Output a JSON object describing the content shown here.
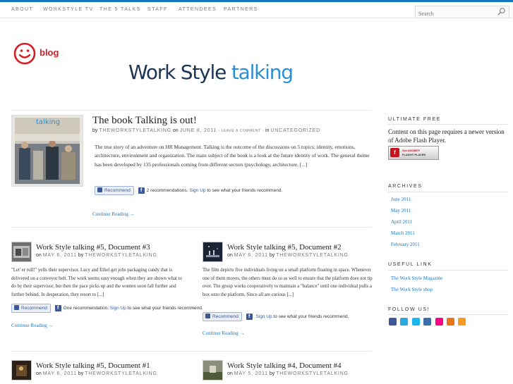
{
  "nav": {
    "items": [
      "About",
      "Workstyle TV",
      "The 5 Talks",
      "Staff",
      "Attendees",
      "Partners"
    ],
    "search_placeholder": "Search"
  },
  "header": {
    "blog_label": "blog",
    "logo_part1": "Work Style",
    "logo_part2": "talking"
  },
  "featured": {
    "title": "The book Talking is out!",
    "by": "by",
    "author": "THEWORKSTYLETALKING",
    "on": "on",
    "date": "JUNE 8, 2011",
    "sep": "·",
    "leave_comment": "LEAVE A COMMENT",
    "in": "in",
    "category": "UNCATEGORIZED",
    "thumb_caption": "talking",
    "excerpt": "The true story of an adventure on HR Management. Talking is the outcome of the discussions on 5 topics: identity, emotions, architecture, environment and organization. The main subject of the book is a look at the future identity of work. The general theme has been developed by 135 professionals coming from different sectors (psychology, architecture, [...]",
    "recommend_label": "Recommend",
    "fb_text": "2 recommendations.",
    "fb_signup": "Sign Up",
    "fb_rest": "to see what your friends recommend.",
    "continue": "Continue Reading →"
  },
  "posts": [
    {
      "title": "Work Style talking #5, Document #3",
      "on": "on",
      "date": "MAY 6, 2011",
      "by": "by",
      "author": "THEWORKSTYLETALKING",
      "excerpt": "\"Let' er roll!\" yells their supervisor. Lucy and Ethel get jobs packaging candy that is delivered on a conveyor belt. The work seems easy enough when they are shown what to do by their supervisor, but then the pace picks up and the women soon fall further and further behind. In desperation, they resort to [...]",
      "recommend_label": "Recommend",
      "fb_text": "One recommendation.",
      "fb_signup": "Sign Up",
      "fb_rest": "to see what your friends recommend.",
      "continue": "Continue Reading →"
    },
    {
      "title": "Work Style talking #5, Document #2",
      "on": "on",
      "date": "MAY 6, 2011",
      "by": "by",
      "author": "THEWORKSTYLETALKING",
      "excerpt": "The film depicts five individuals living on a small platform floating in space. Whenever one of them moves, the others must do so as well to ensure that the platform does not tip over. The group works cooperatively to maintain a \"balance\" until one individual pulls a box onto the platform. Since all are curious [...]",
      "recommend_label": "Recommend",
      "fb_text": "",
      "fb_signup": "Sign Up",
      "fb_rest": "to see what your friends recommend.",
      "continue": "Continue Reading →"
    },
    {
      "title": "Work Style talking #5, Document #1",
      "on": "on",
      "date": "MAY 6, 2011",
      "by": "by",
      "author": "THEWORKSTYLETALKING"
    },
    {
      "title": "Work Style talking #4, Document #4",
      "on": "on",
      "date": "MAY 5, 2011",
      "by": "by",
      "author": "THEWORKSTYLETALKING"
    }
  ],
  "sidebar": {
    "ultimate_title": "Ultimate Free",
    "flash_text": "Content on this page requires a newer version of Adobe Flash Player.",
    "flash_btn_line1": "Get ADOBE®",
    "flash_btn_line2": "FLASH® PLAYER",
    "archives_title": "Archives",
    "archives": [
      "June 2011",
      "May 2011",
      "April 2011",
      "March 2011",
      "February 2011"
    ],
    "useful_title": "Useful Link",
    "useful_links": [
      "The Work Style Magazine",
      "The Work Style shop"
    ],
    "follow_title": "Follow us!",
    "social_icons": [
      "facebook-icon",
      "twitter-icon",
      "vimeo-icon",
      "email-icon",
      "flickr-icon",
      "blogger-icon",
      "rss-icon"
    ]
  },
  "colors": {
    "accent": "#1a78c2",
    "brand_red": "#d31e26",
    "logo_dark": "#1d3557",
    "logo_blue": "#2b8fd6",
    "facebook": "#3b5998"
  }
}
